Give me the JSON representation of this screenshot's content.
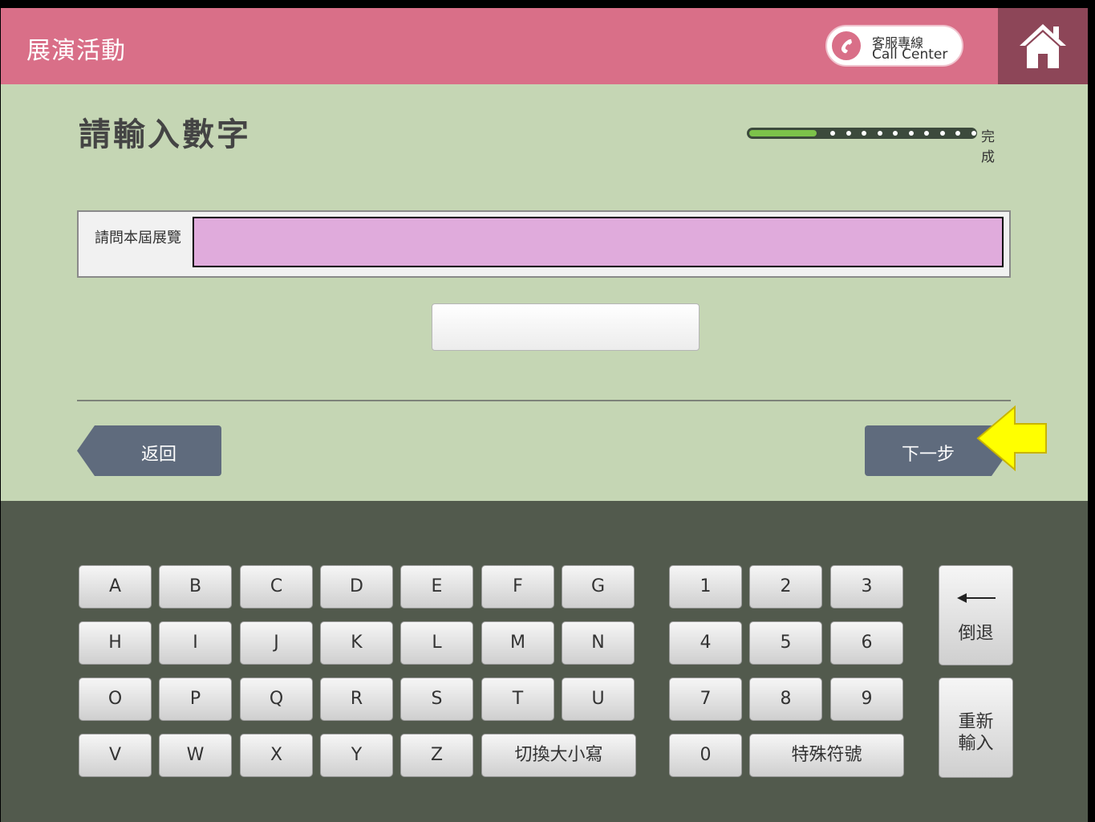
{
  "header": {
    "app_title": "展演活動",
    "call_center_zh": "客服專線",
    "call_center_en": "Call Center"
  },
  "page": {
    "title": "請輸入數字",
    "progress": {
      "label": "完成",
      "fraction": 0.3
    },
    "question_text": "請問本屆展覽",
    "answer_value": "",
    "back_label": "返回",
    "next_label": "下一步"
  },
  "keyboard": {
    "letters": [
      [
        "A",
        "B",
        "C",
        "D",
        "E",
        "F",
        "G"
      ],
      [
        "H",
        "I",
        "J",
        "K",
        "L",
        "M",
        "N"
      ],
      [
        "O",
        "P",
        "Q",
        "R",
        "S",
        "T",
        "U"
      ],
      [
        "V",
        "W",
        "X",
        "Y",
        "Z"
      ]
    ],
    "case_toggle_label": "切換大小寫",
    "digits": [
      [
        "1",
        "2",
        "3"
      ],
      [
        "4",
        "5",
        "6"
      ],
      [
        "7",
        "8",
        "9"
      ],
      [
        "0"
      ]
    ],
    "special_label": "特殊符號",
    "backspace_label": "倒退",
    "reset_label_line1": "重新",
    "reset_label_line2": "輸入"
  },
  "colors": {
    "header_bg": "#d96f88",
    "home_bg": "#8d4658",
    "content_bg": "#c5d6b4",
    "keyboard_bg": "#525a4d",
    "nav_button": "#5f6b7d",
    "progress_fill": "#7cc24a",
    "pointer_arrow": "#ffff00"
  }
}
